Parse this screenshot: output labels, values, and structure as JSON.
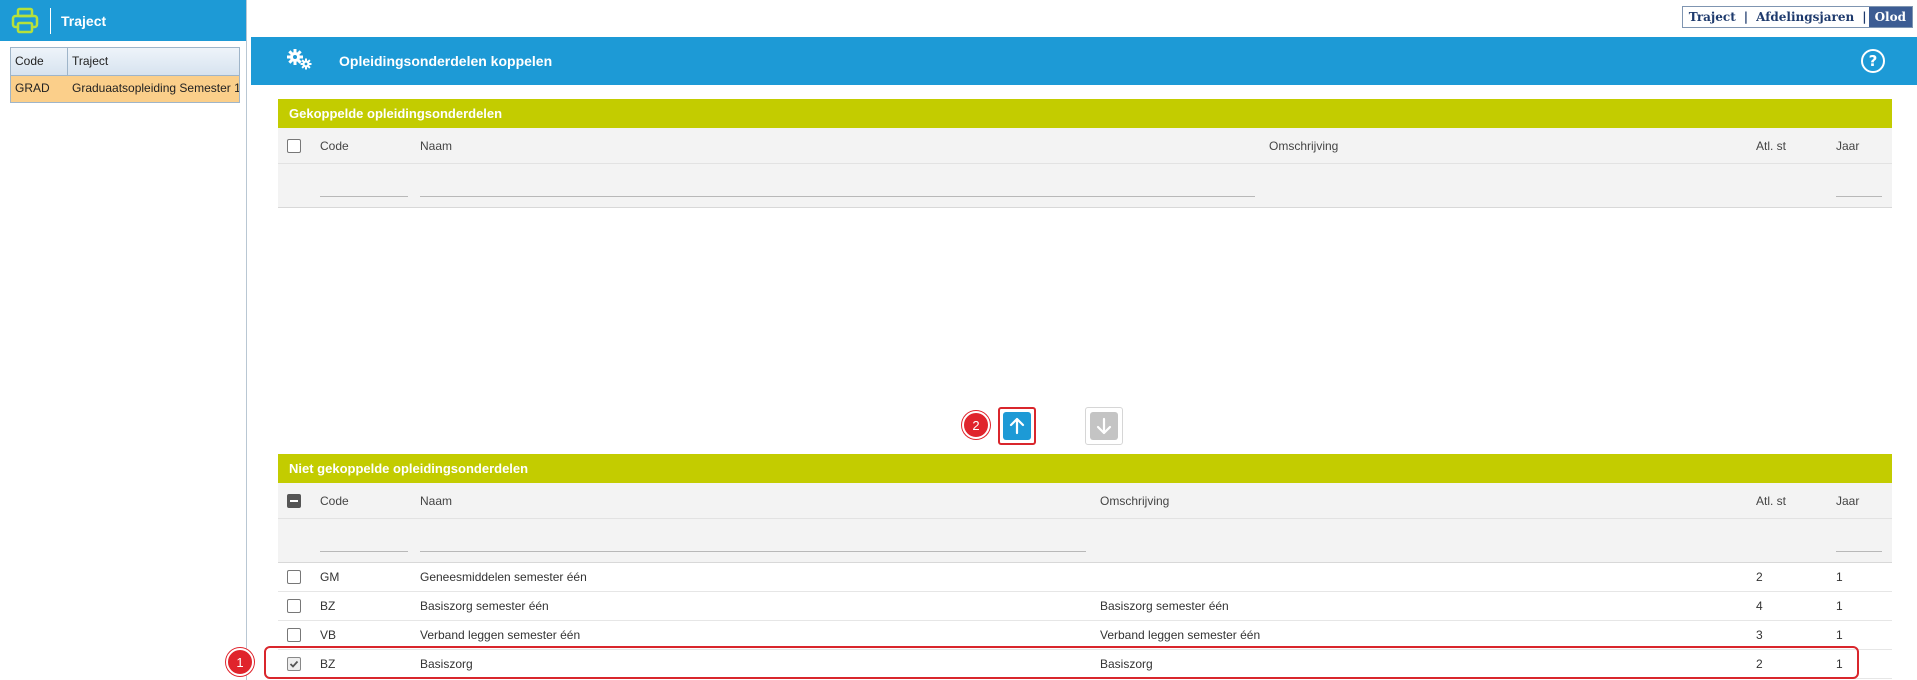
{
  "left_panel": {
    "title": "Traject",
    "columns": [
      "Code",
      "Traject"
    ],
    "rows": [
      {
        "code": "GRAD",
        "traject": "Graduaatsopleiding Semester 1"
      }
    ]
  },
  "top_tabs": {
    "items": [
      "Traject",
      "Afdelingsjaren",
      "Olod"
    ],
    "separator": "|",
    "active": "Olod"
  },
  "main_header": {
    "title": "Opleidingsonderdelen koppelen",
    "help": "?"
  },
  "linked": {
    "title": "Gekoppelde opleidingsonderdelen",
    "columns": {
      "code": "Code",
      "naam": "Naam",
      "omschrijving": "Omschrijving",
      "atl": "Atl. st",
      "jaar": "Jaar"
    }
  },
  "unlinked": {
    "title": "Niet gekoppelde opleidingsonderdelen",
    "columns": {
      "code": "Code",
      "naam": "Naam",
      "omschrijving": "Omschrijving",
      "atl": "Atl. st",
      "jaar": "Jaar"
    },
    "rows": [
      {
        "code": "GM",
        "naam": "Geneesmiddelen semester één",
        "omschrijving": "",
        "atl": "2",
        "jaar": "1",
        "checked": false
      },
      {
        "code": "BZ",
        "naam": "Basiszorg semester één",
        "omschrijving": "Basiszorg semester één",
        "atl": "4",
        "jaar": "1",
        "checked": false
      },
      {
        "code": "VB",
        "naam": "Verband leggen semester één",
        "omschrijving": "Verband leggen semester één",
        "atl": "3",
        "jaar": "1",
        "checked": false
      },
      {
        "code": "BZ",
        "naam": "Basiszorg",
        "omschrijving": "Basiszorg",
        "atl": "2",
        "jaar": "1",
        "checked": true
      }
    ]
  },
  "badges": {
    "step1": "1",
    "step2": "2"
  },
  "colors": {
    "header_blue": "#1d9ad6",
    "section_green": "#c3cc00",
    "selected_row": "#fbcf8a",
    "highlight_red": "#d9262c"
  }
}
